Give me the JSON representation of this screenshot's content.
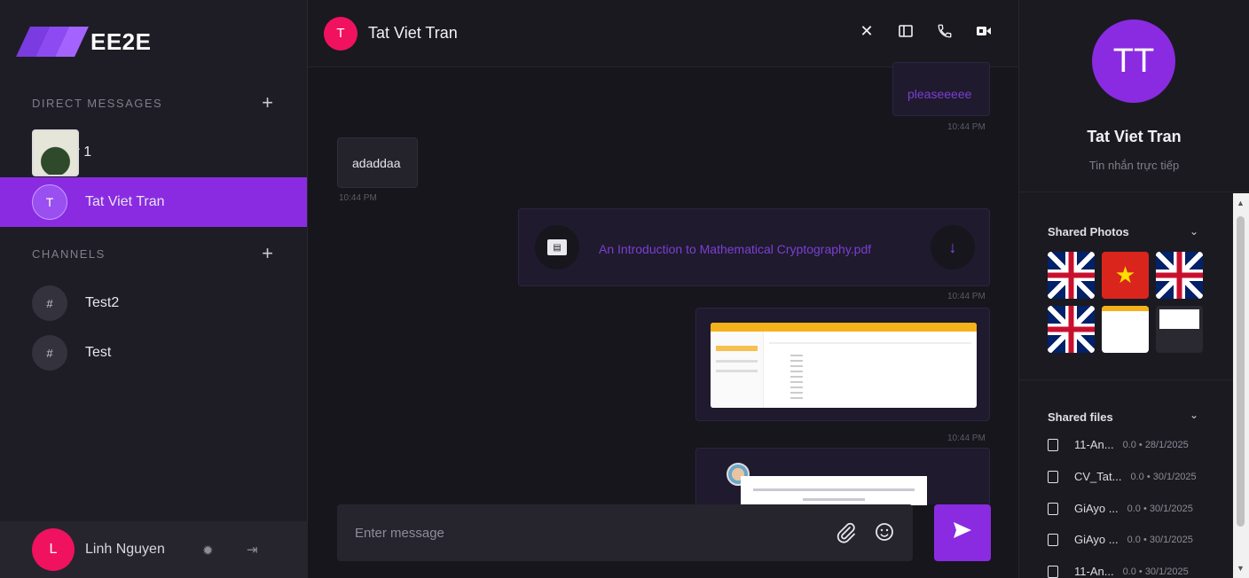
{
  "brand": {
    "name": "EE2E"
  },
  "sidebar": {
    "dm_header": "DIRECT MESSAGES",
    "dm_add": "+",
    "dms": [
      {
        "label": "User 1",
        "avatar": ""
      },
      {
        "label": "Tat Viet Tran",
        "avatar": "T"
      }
    ],
    "channels_header": "CHANNELS",
    "channels_add": "+",
    "channels": [
      {
        "label": "Test2",
        "avatar": "#"
      },
      {
        "label": "Test",
        "avatar": "#"
      }
    ],
    "me": {
      "name": "Linh Nguyen",
      "avatar": "L"
    }
  },
  "chat": {
    "peer_avatar": "T",
    "peer_name": "Tat Viet Tran",
    "messages": {
      "m1_text": "pleaseeeee",
      "m1_time": "10:44 PM",
      "m2_text": "adaddaa",
      "m2_time": "10:44 PM",
      "file_name": "An Introduction to Mathematical Cryptography.pdf",
      "m3_time": "10:44 PM",
      "m4_time": "10:44 PM"
    },
    "composer_placeholder": "Enter message"
  },
  "profile": {
    "avatar": "TT",
    "name": "Tat Viet Tran",
    "subtitle": "Tin nhắn trực tiếp",
    "shared_photos_label": "Shared Photos",
    "shared_files_label": "Shared files",
    "files": [
      {
        "name": "11-An...",
        "meta": "0.0 • 28/1/2025"
      },
      {
        "name": "CV_Tat...",
        "meta": "0.0 • 30/1/2025"
      },
      {
        "name": "GiAyo ...",
        "meta": "0.0 • 30/1/2025"
      },
      {
        "name": "GiAyo ...",
        "meta": "0.0 • 30/1/2025"
      },
      {
        "name": "11-An...",
        "meta": "0.0 • 30/1/2025"
      }
    ]
  },
  "colors": {
    "accent": "#8a2be2",
    "peer_avatar": "#f0125e",
    "bg": "#17161d"
  }
}
